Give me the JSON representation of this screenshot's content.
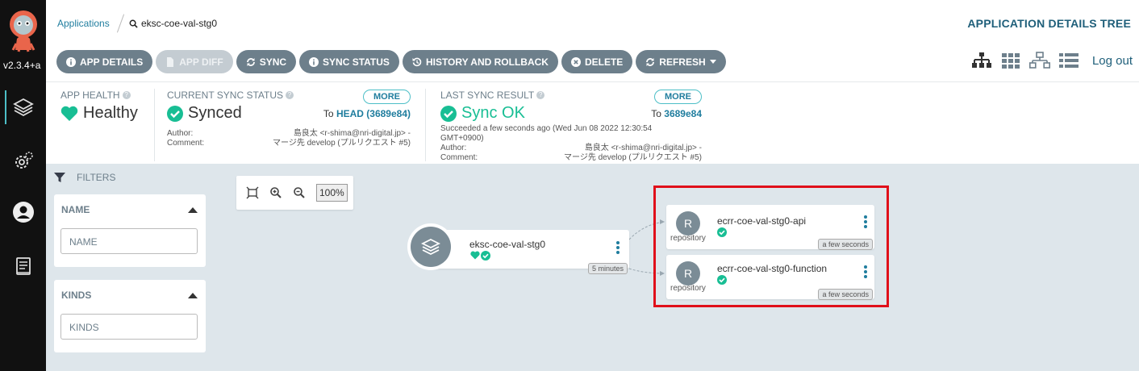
{
  "sidebar": {
    "version": "v2.3.4+a"
  },
  "topbar": {
    "breadcrumb_link": "Applications",
    "breadcrumb_current": "eksc-coe-val-stg0",
    "page_title": "APPLICATION DETAILS TREE"
  },
  "toolbar": {
    "app_details": "APP DETAILS",
    "app_diff": "APP DIFF",
    "sync": "SYNC",
    "sync_status": "SYNC STATUS",
    "history": "HISTORY AND ROLLBACK",
    "delete": "DELETE",
    "refresh": "REFRESH",
    "logout": "Log out"
  },
  "status": {
    "health_label": "APP HEALTH",
    "health_value": "Healthy",
    "sync_label": "CURRENT SYNC STATUS",
    "sync_value": "Synced",
    "sync_more": "MORE",
    "sync_to_prefix": "To",
    "sync_to_rev": "HEAD (3689e84)",
    "sync_author_label": "Author:",
    "sync_author": "島良太 <r-shima@nri-digital.jp> -",
    "sync_comment_label": "Comment:",
    "sync_comment": "マージ先 develop (プルリクエスト #5)",
    "last_label": "LAST SYNC RESULT",
    "last_value": "Sync OK",
    "last_more": "MORE",
    "last_to_prefix": "To",
    "last_to_rev": "3689e84",
    "last_time_1": "Succeeded a few seconds ago (Wed Jun 08 2022 12:30:54",
    "last_time_2": "GMT+0900)",
    "last_author_label": "Author:",
    "last_author": "島良太 <r-shima@nri-digital.jp> -",
    "last_comment_label": "Comment:",
    "last_comment": "マージ先 develop (プルリクエスト #5)"
  },
  "filters": {
    "header": "FILTERS",
    "name_title": "NAME",
    "name_placeholder": "NAME",
    "kinds_title": "KINDS",
    "kinds_placeholder": "KINDS"
  },
  "graph": {
    "zoom_level": "100%",
    "app_node": {
      "name": "eksc-coe-val-stg0",
      "age": "5 minutes"
    },
    "repo_nodes": [
      {
        "initial": "R",
        "kind": "repository",
        "name": "ecrr-coe-val-stg0-api",
        "age": "a few seconds"
      },
      {
        "initial": "R",
        "kind": "repository",
        "name": "ecrr-coe-val-stg0-function",
        "age": "a few seconds"
      }
    ]
  },
  "colors": {
    "accent": "#1f7d9e",
    "healthy": "#18be94",
    "toolbar_button": "#6d7f8b",
    "highlight_box": "#e0101a"
  }
}
